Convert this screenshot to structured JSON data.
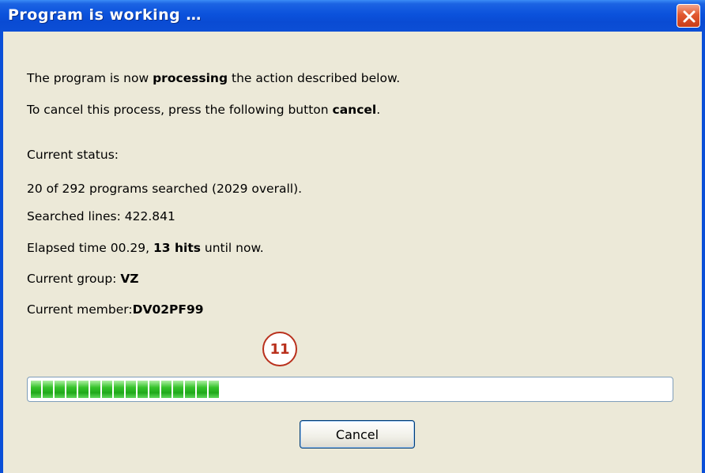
{
  "window": {
    "title": "Program is working …",
    "close_icon": "close-icon"
  },
  "message": {
    "line1_pre": "The program is now ",
    "line1_bold": "processing",
    "line1_post": " the action described below.",
    "line2_pre": "To cancel this process, press the following button ",
    "line2_bold": "cancel",
    "line2_post": "."
  },
  "status": {
    "heading": "Current status:",
    "programs": "20 of 292 programs searched (2029 overall).",
    "lines": "Searched lines: 422.841",
    "elapsed_pre": "Elapsed time 00.29, ",
    "elapsed_bold": "13 hits",
    "elapsed_post": " until now.",
    "group_label": "Current group: ",
    "group_value": "VZ",
    "member_label": "Current member:",
    "member_value": "DV02PF99"
  },
  "annotation": {
    "marker_number": "11"
  },
  "progress": {
    "fraction": 0.31,
    "segment_count": 16,
    "color": "#35c22a"
  },
  "buttons": {
    "cancel_label": "Cancel"
  },
  "colors": {
    "titlebar": "#0a4fd8",
    "client_bg": "#ece9d8",
    "close_bg": "#e2582f",
    "marker": "#b9301c"
  }
}
